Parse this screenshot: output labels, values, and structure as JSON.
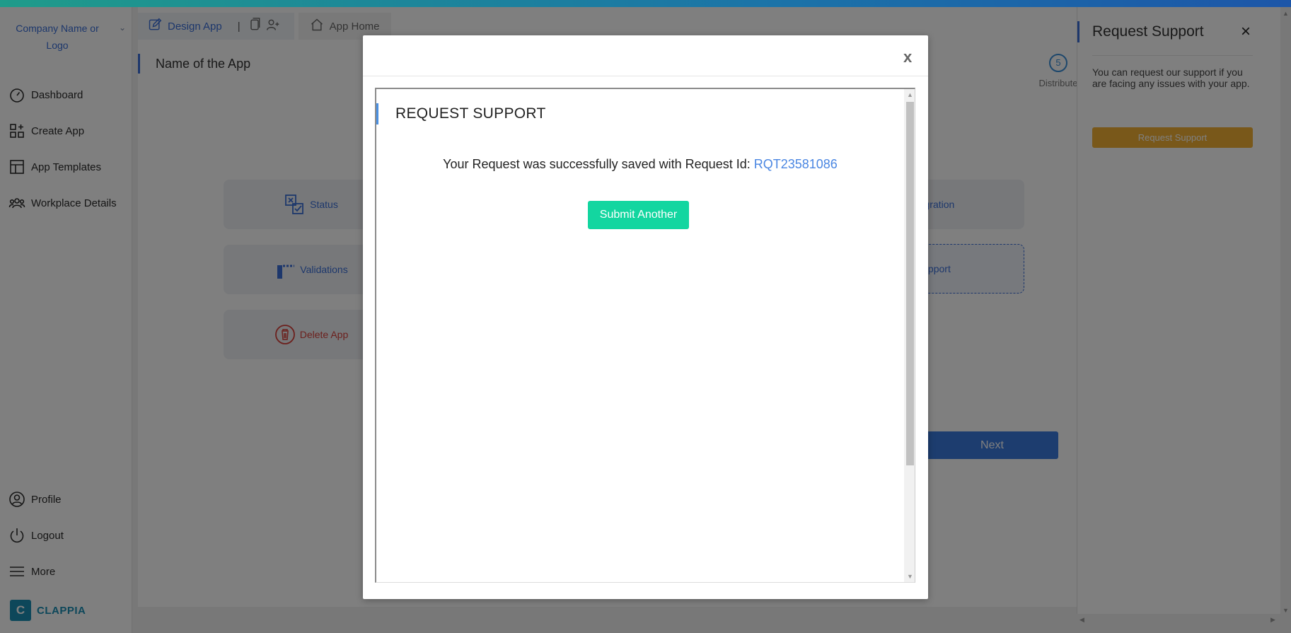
{
  "sidebar": {
    "company_line1": "Company Name or",
    "company_line2": "Logo",
    "items": [
      {
        "label": "Dashboard"
      },
      {
        "label": "Create App"
      },
      {
        "label": "App Templates"
      },
      {
        "label": "Workplace Details"
      }
    ],
    "bottom_items": [
      {
        "label": "Profile"
      },
      {
        "label": "Logout"
      },
      {
        "label": "More"
      }
    ],
    "brand_letter": "C",
    "brand_name": "CLAPPIA"
  },
  "main": {
    "tabs": {
      "design": "Design App",
      "separator": "|",
      "home": "App Home"
    },
    "app_name": "Name of the App",
    "step": {
      "number": "5",
      "label": "Distribute"
    },
    "cards": {
      "status": "Status",
      "validations": "Validations",
      "delete": "Delete App",
      "integration": "egration",
      "support": "upport"
    },
    "next_label": "Next"
  },
  "right_panel": {
    "title": "Request Support",
    "close": "×",
    "description": "You can request our support if you are facing any issues with your app.",
    "button": "Request Support"
  },
  "modal": {
    "close": "x",
    "title": "REQUEST SUPPORT",
    "message_prefix": "Your Request was successfully saved with Request Id:",
    "request_id": "RQT23581086",
    "submit_another": "Submit Another"
  },
  "colors": {
    "accent": "#3a6fd8",
    "submit": "#13d6a0",
    "support_button": "#f2b134",
    "delete": "#d8403a"
  }
}
